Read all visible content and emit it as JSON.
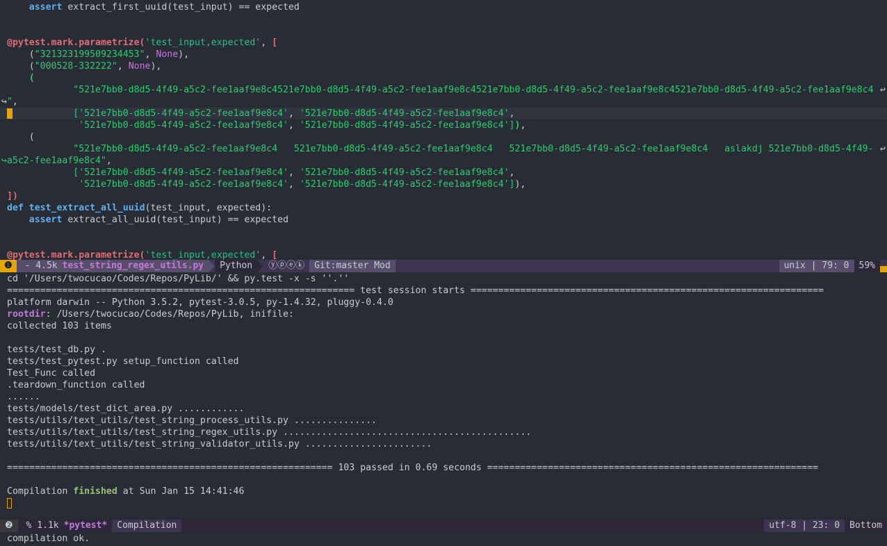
{
  "editor": {
    "lines": [
      {
        "segs": [
          [
            "",
            "    "
          ],
          [
            "kw",
            "assert"
          ],
          [
            "",
            " extract_first_uuid(test_input) == expected"
          ]
        ]
      },
      {
        "segs": []
      },
      {
        "segs": []
      },
      {
        "segs": [
          [
            "dec",
            "@pytest.mark.parametrize("
          ],
          [
            "strd",
            "'test_input,expected'"
          ],
          [
            "",
            ", "
          ],
          [
            "br",
            "["
          ]
        ]
      },
      {
        "segs": [
          [
            "",
            "    ("
          ],
          [
            "str",
            "\"321323199509234453\""
          ],
          [
            "",
            ", "
          ],
          [
            "none",
            "None"
          ],
          [
            "",
            "),"
          ]
        ]
      },
      {
        "segs": [
          [
            "",
            "    ("
          ],
          [
            "str",
            "\"000528-332222\""
          ],
          [
            "",
            ", "
          ],
          [
            "none",
            "None"
          ],
          [
            "",
            "),"
          ]
        ]
      },
      {
        "segs": [
          [
            "",
            "    "
          ],
          [
            "brg",
            "("
          ]
        ]
      },
      {
        "segs": [
          [
            "",
            "            "
          ],
          [
            "str",
            "\"521e7bb0-d8d5-4f49-a5c2-fee1aaf9e8c4521e7bb0-d8d5-4f49-a5c2-fee1aaf9e8c4521e7bb0-d8d5-4f49-a5c2-fee1aaf9e8c4521e7bb0-d8d5-4f49-a5c2-fee1aaf9e8c4"
          ]
        ],
        "wrap": "↩"
      },
      {
        "segs": [
          [
            "",
            "↪"
          ],
          [
            "str",
            "\""
          ],
          [
            "",
            ","
          ]
        ],
        "nopad": true
      },
      {
        "segs": [
          [
            "",
            "            "
          ],
          [
            "str",
            "['521e7bb0-d8d5-4f49-a5c2-fee1aaf9e8c4'"
          ],
          [
            "",
            ", "
          ],
          [
            "str",
            "'521e7bb0-d8d5-4f49-a5c2-fee1aaf9e8c4'"
          ],
          [
            "",
            ","
          ]
        ],
        "current": true
      },
      {
        "segs": [
          [
            "",
            "             "
          ],
          [
            "str",
            "'521e7bb0-d8d5-4f49-a5c2-fee1aaf9e8c4'"
          ],
          [
            "",
            ", "
          ],
          [
            "str",
            "'521e7bb0-d8d5-4f49-a5c2-fee1aaf9e8c4']"
          ],
          [
            "brg",
            ")"
          ],
          [
            "",
            ","
          ]
        ]
      },
      {
        "segs": [
          [
            "",
            "    ("
          ]
        ]
      },
      {
        "segs": [
          [
            "",
            "            "
          ],
          [
            "str",
            "\"521e7bb0-d8d5-4f49-a5c2-fee1aaf9e8c4   521e7bb0-d8d5-4f49-a5c2-fee1aaf9e8c4   521e7bb0-d8d5-4f49-a5c2-fee1aaf9e8c4   aslakdj 521e7bb0-d8d5-4f49-"
          ]
        ],
        "wrap": "↩"
      },
      {
        "segs": [
          [
            "str",
            "↪a5c2-fee1aaf9e8c4\""
          ],
          [
            "",
            ","
          ]
        ],
        "nopad": true
      },
      {
        "segs": [
          [
            "",
            "            "
          ],
          [
            "str",
            "['521e7bb0-d8d5-4f49-a5c2-fee1aaf9e8c4'"
          ],
          [
            "",
            ", "
          ],
          [
            "str",
            "'521e7bb0-d8d5-4f49-a5c2-fee1aaf9e8c4'"
          ],
          [
            "",
            ","
          ]
        ]
      },
      {
        "segs": [
          [
            "",
            "             "
          ],
          [
            "str",
            "'521e7bb0-d8d5-4f49-a5c2-fee1aaf9e8c4'"
          ],
          [
            "",
            ", "
          ],
          [
            "str",
            "'521e7bb0-d8d5-4f49-a5c2-fee1aaf9e8c4']"
          ],
          [
            "",
            "),"
          ]
        ]
      },
      {
        "segs": [
          [
            "br",
            "])"
          ]
        ]
      },
      {
        "segs": [
          [
            "kw",
            "def"
          ],
          [
            "",
            " "
          ],
          [
            "fn",
            "test_extract_all_uuid"
          ],
          [
            "",
            "(test_input, expected):"
          ]
        ]
      },
      {
        "segs": [
          [
            "",
            "    "
          ],
          [
            "kw",
            "assert"
          ],
          [
            "",
            " extract_all_uuid(test_input) == expected"
          ]
        ]
      },
      {
        "segs": []
      },
      {
        "segs": []
      },
      {
        "segs": [
          [
            "dec",
            "@pytest.mark.parametrize("
          ],
          [
            "strd",
            "'test_input,expected'"
          ],
          [
            "",
            ", "
          ],
          [
            "br",
            "["
          ]
        ]
      }
    ]
  },
  "modeline_top": {
    "badge": "❶",
    "size": "- 4.5k",
    "buffer": "test_string_regex_utils.py",
    "mode": "Python",
    "minor": "ⓨⓟⓔⓚ",
    "vcs": "Git:master Mod",
    "encoding": "unix",
    "position": "79: 0",
    "percent": "59%"
  },
  "terminal": {
    "lines": [
      "cd '/Users/twocucao/Codes/Repos/PyLib/' && py.test -x -s ''.''",
      "=============================================================== test session starts ================================================================",
      "platform darwin -- Python 3.5.2, pytest-3.0.5, py-1.4.32, pluggy-0.4.0",
      "ROOTDIR",
      "collected 103 items",
      "",
      "tests/test_db.py .",
      "tests/test_pytest.py setup_function called",
      "Test_Func called",
      ".teardown_function called",
      "......",
      "tests/models/test_dict_area.py ............",
      "tests/utils/text_utils/test_string_process_utils.py ...............",
      "tests/utils/text_utils/test_string_regex_utils.py .............................................",
      "tests/utils/text_utils/test_string_validator_utils.py .......................",
      "",
      "=========================================================== 103 passed in 0.69 seconds ============================================================",
      "",
      "FINISHED"
    ],
    "rootdir_label": "rootdir",
    "rootdir_value": ": /Users/twocucao/Codes/Repos/PyLib, inifile:",
    "compilation_prefix": "Compilation ",
    "compilation_status": "finished",
    "compilation_suffix": " at Sun Jan 15 14:41:46"
  },
  "modeline_bottom": {
    "badge": "❷",
    "size": "% 1.1k",
    "buffer": "*pytest*",
    "mode": "Compilation",
    "encoding": "utf-8",
    "position": "23: 0",
    "percent": "Bottom"
  },
  "echo_area": "compilation ok.",
  "colors": {
    "accent": "#e5a50a",
    "modeline": "#3e3650",
    "background": "#282c34"
  }
}
